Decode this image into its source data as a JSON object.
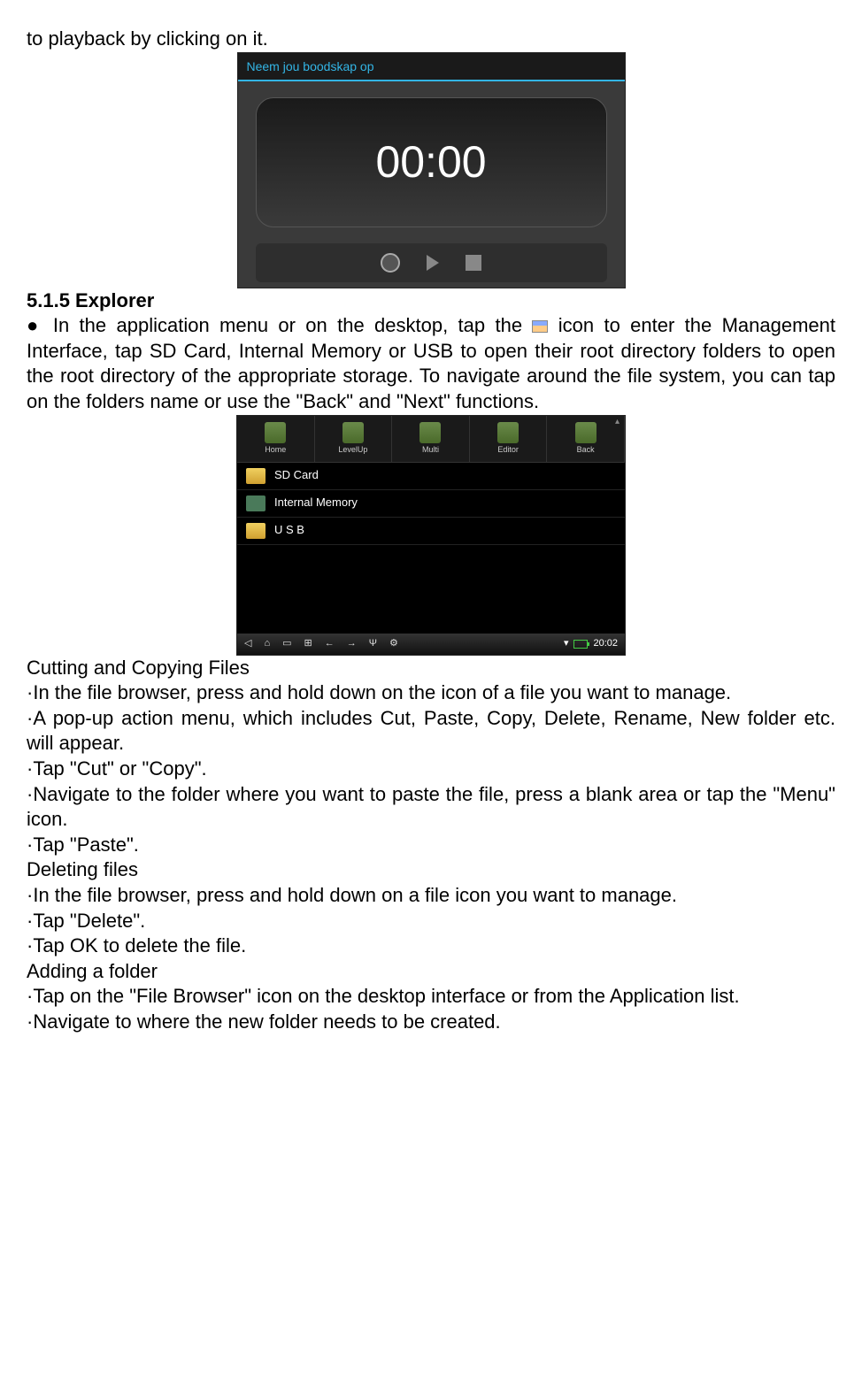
{
  "intro": "to playback by clicking on it.",
  "recorder": {
    "header": "Neem jou boodskap op",
    "time": "00:00"
  },
  "section_heading": "5.1.5 Explorer",
  "explorer_para_before": "● In the application menu or on the desktop, tap the ",
  "explorer_para_after": " icon to enter the Management Interface, tap SD Card, Internal Memory or USB to open their root directory folders to open the root directory of the appropriate storage. To navigate around the file system, you can tap on the folders name or use the \"Back\" and \"Next\" functions.",
  "explorer_shot": {
    "toolbar": [
      "Home",
      "LevelUp",
      "Multi",
      "Editor",
      "Back"
    ],
    "rows": [
      "SD Card",
      "Internal Memory",
      "U S B"
    ],
    "time": "20:02"
  },
  "cut_heading": "Cutting and Copying Files",
  "cut_step1": "·In the file browser, press and hold down on the icon of a file you want to manage.",
  "cut_step2": "·A pop-up action menu, which includes Cut, Paste, Copy, Delete, Rename, New folder etc. will appear.",
  "cut_step3": "·Tap \"Cut\" or \"Copy\".",
  "cut_step4": "·Navigate to the folder where you want to paste the file, press a blank area or tap the \"Menu\" icon.",
  "cut_step5": "·Tap \"Paste\".",
  "del_heading": "Deleting files",
  "del_step1": "·In the file browser, press and hold down on a file icon you want to manage.",
  "del_step2": "·Tap \"Delete\".",
  "del_step3": "·Tap OK to delete the file.",
  "add_heading": "Adding a folder",
  "add_step1": "·Tap on the \"File Browser\" icon on the desktop interface or from the Application list.",
  "add_step2": "·Navigate to where the new folder needs to be created."
}
